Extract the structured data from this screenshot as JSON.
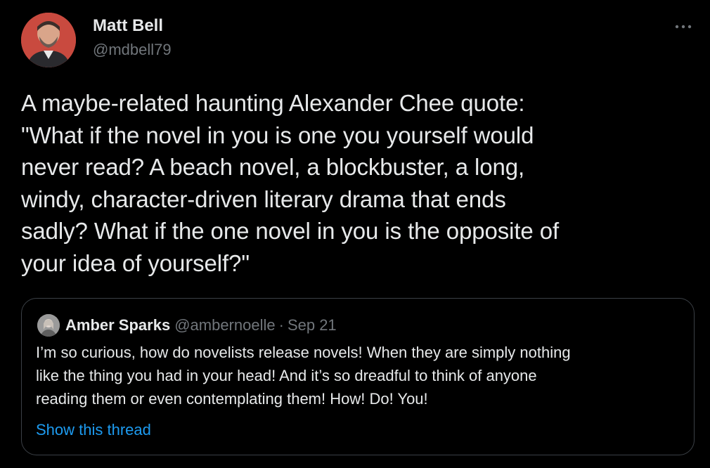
{
  "tweet": {
    "author": {
      "display_name": "Matt Bell",
      "handle": "@mdbell79",
      "avatar_icon": "profile-photo"
    },
    "more_icon": "ellipsis-icon",
    "text": "A maybe-related haunting Alexander Chee quote:\n\"What if the novel in you is one you yourself would\nnever read? A beach novel, a blockbuster, a long,\nwindy, character-driven literary drama that ends\nsadly? What if the one novel in you is the opposite of\nyour idea of yourself?\""
  },
  "quoted_tweet": {
    "author": {
      "display_name": "Amber Sparks",
      "handle": "@ambernoelle",
      "avatar_icon": "profile-photo"
    },
    "separator": "·",
    "date": "Sep 21",
    "text": "I’m so curious, how do novelists release novels! When they are simply nothing\nlike the thing you had in your head! And it’s so dreadful to think of anyone\nreading them or even contemplating them! How! Do! You!",
    "show_thread_label": "Show this thread"
  },
  "colors": {
    "background": "#000000",
    "primary_text": "#e7e9ea",
    "secondary_text": "#71767b",
    "link": "#1d9bf0",
    "border": "#3b4046"
  }
}
